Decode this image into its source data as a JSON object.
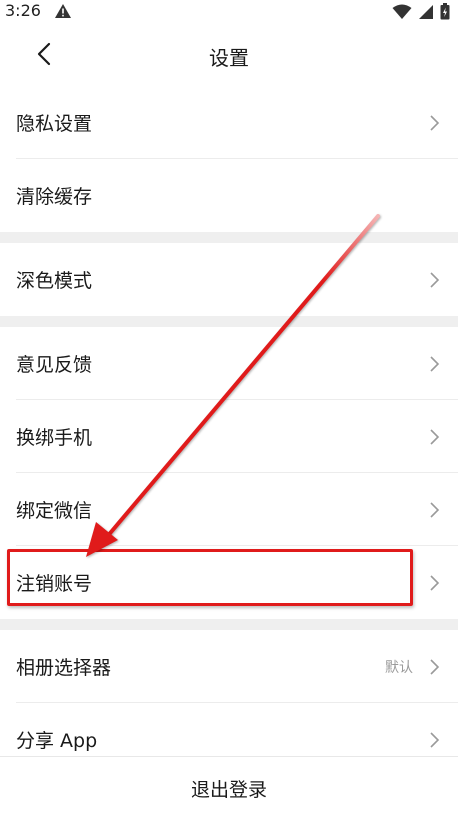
{
  "status_bar": {
    "time": "3:26",
    "icons": [
      "alert-icon",
      "wifi-icon",
      "signal-icon",
      "battery-icon"
    ]
  },
  "header": {
    "title": "设置",
    "back_icon": "chevron-left-icon"
  },
  "groups": [
    {
      "items": [
        {
          "label": "隐私设置",
          "chevron": true
        },
        {
          "label": "清除缓存",
          "chevron": false
        }
      ]
    },
    {
      "items": [
        {
          "label": "深色模式",
          "chevron": true
        }
      ]
    },
    {
      "items": [
        {
          "label": "意见反馈",
          "chevron": true
        },
        {
          "label": "换绑手机",
          "chevron": true
        },
        {
          "label": "绑定微信",
          "chevron": true
        },
        {
          "label": "注销账号",
          "chevron": true,
          "highlighted": true
        }
      ]
    },
    {
      "items": [
        {
          "label": "相册选择器",
          "value": "默认",
          "chevron": true
        },
        {
          "label": "分享 App",
          "chevron": true
        }
      ]
    }
  ],
  "footer": {
    "logout_label": "退出登录"
  },
  "colors": {
    "annotation": "#e01b1b",
    "section_gap": "#efefef",
    "chevron": "#9a9a9a"
  }
}
